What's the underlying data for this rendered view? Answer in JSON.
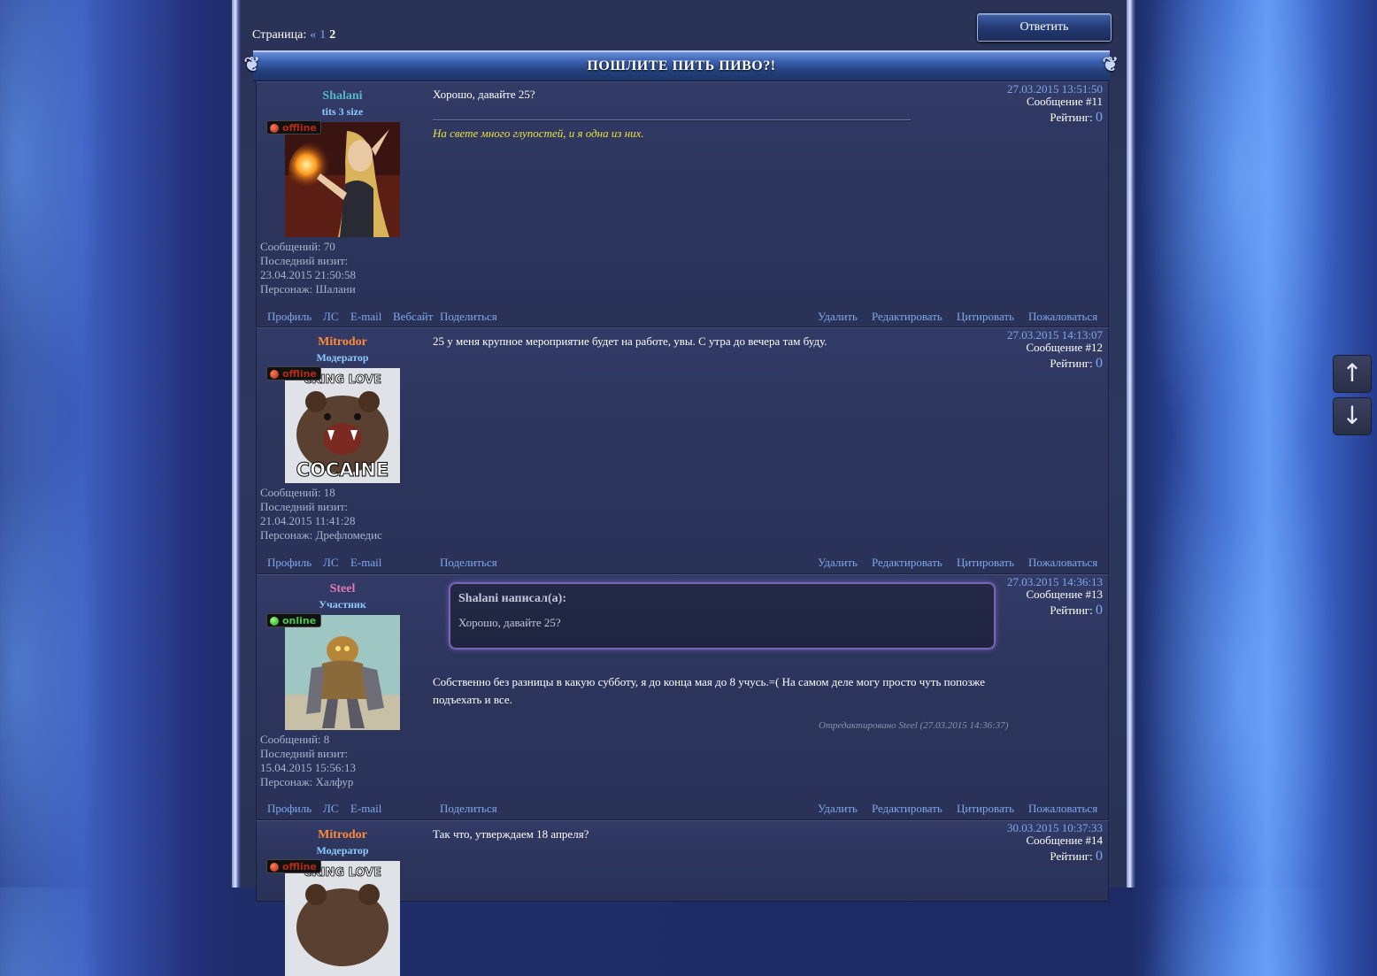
{
  "pager": {
    "label": "Страница:",
    "prev": "«",
    "page1": "1",
    "current": "2"
  },
  "reply_button": "Ответить",
  "topic_title": "ПОШЛИТЕ ПИТЬ ПИВО?!",
  "scroll": {
    "up": "↑",
    "down": "↓"
  },
  "colors": {
    "accent_link": "#7fa8ec",
    "signature": "#e9e33c",
    "quote_border": "#7c63b8"
  },
  "posts": [
    {
      "author": "Shalani",
      "author_color": "#56b6c8",
      "rank": "tits 3 size",
      "status": "offline",
      "avatar": "elf-mage-icon",
      "messages": "Сообщений: 70",
      "last_visit_label": "Последний визит:",
      "last_visit": "23.04.2015 21:50:58",
      "character": "Персонаж: Шалани",
      "date": "27.03.2015 13:51:50",
      "number": "Сообщение #11",
      "rating_label": "Рейтинг:",
      "rating": "0",
      "text": "Хорошо, давайте 25?",
      "signature": "На свете много глупостей, и я одна из них.",
      "actions": {
        "profile": "Профиль",
        "pm": "ЛС",
        "email": "E-mail",
        "website": "Вебсайт",
        "share": "Поделиться",
        "delete": "Удалить",
        "edit": "Редактировать",
        "quote": "Цитировать",
        "report": "Пожаловаться"
      }
    },
    {
      "author": "Mitrodor",
      "author_color": "#ff8a3a",
      "rank": "Модератор",
      "status": "offline",
      "avatar": "bear-meme-icon",
      "avatar_top_text": "CKING LOVE",
      "avatar_bottom_text": "COCAINE",
      "messages": "Сообщений: 18",
      "last_visit_label": "Последний визит:",
      "last_visit": "21.04.2015 11:41:28",
      "character": "Персонаж: Дрефломедис",
      "date": "27.03.2015 14:13:07",
      "number": "Сообщение #12",
      "rating_label": "Рейтинг:",
      "rating": "0",
      "text": "25 у меня крупное мероприятие будет на работе, увы. С утра до вечера там буду.",
      "actions": {
        "profile": "Профиль",
        "pm": "ЛС",
        "email": "E-mail",
        "share": "Поделиться",
        "delete": "Удалить",
        "edit": "Редактировать",
        "quote": "Цитировать",
        "report": "Пожаловаться"
      }
    },
    {
      "author": "Steel",
      "author_color": "#e07ab8",
      "rank": "Участник",
      "status": "online",
      "avatar": "robot-warrior-icon",
      "messages": "Сообщений: 8",
      "last_visit_label": "Последний визит:",
      "last_visit": "15.04.2015 15:56:13",
      "character": "Персонаж: Халфур",
      "date": "27.03.2015 14:36:13",
      "number": "Сообщение #13",
      "rating_label": "Рейтинг:",
      "rating": "0",
      "quote_header": "Shalani написал(а):",
      "quote_text": "Хорошо, давайте 25?",
      "text_line1": "Собственно без разницы в какую субботу, я до конца мая до 8 учусь.=( На самом деле могу просто чуть попозже",
      "text_line2": "подъехать и все.",
      "edited": "Отредактировано Steel (27.03.2015 14:36:37)",
      "actions": {
        "profile": "Профиль",
        "pm": "ЛС",
        "email": "E-mail",
        "share": "Поделиться",
        "delete": "Удалить",
        "edit": "Редактировать",
        "quote": "Цитировать",
        "report": "Пожаловаться"
      }
    },
    {
      "author": "Mitrodor",
      "author_color": "#ff8a3a",
      "rank": "Модератор",
      "status": "offline",
      "avatar": "bear-meme-icon",
      "avatar_top_text": "CKING LOVE",
      "date": "30.03.2015 10:37:33",
      "number": "Сообщение #14",
      "rating_label": "Рейтинг:",
      "rating": "0",
      "text": "Так что, утверждаем 18 апреля?"
    }
  ]
}
